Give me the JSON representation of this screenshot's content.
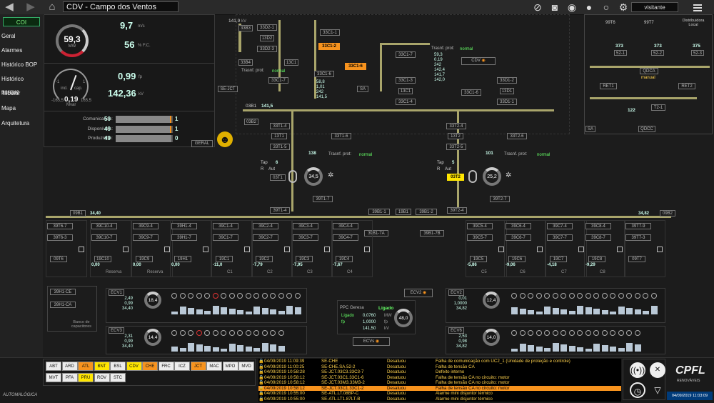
{
  "app": {
    "title": "CDV - Campo dos Ventos",
    "user": "visitante",
    "footer_logo": "AUTOMALÓGICA",
    "brand": "CPFL",
    "brand_sub": "RENOVÁVEIS",
    "datetime": "04/09/2019 11:03:09"
  },
  "toolbar": {
    "back_icon": "back-arrow-icon",
    "forward_icon": "forward-arrow-icon",
    "home_icon": "home-icon",
    "icons": [
      "image-off-icon",
      "camera-icon",
      "eye-icon",
      "user-icon",
      "user-outline-icon",
      "gear-icon"
    ]
  },
  "sidebar": {
    "site": "COI",
    "items": [
      "Geral",
      "Alarmes",
      "Histórico BOP",
      "Histórico parque",
      "Tabular",
      "Mapa",
      "Arquitetura"
    ]
  },
  "summary": {
    "power": "59,3",
    "power_unit": "MW",
    "wind": "9,7",
    "wind_unit": "m/s",
    "fc": "56",
    "fc_unit": "% F.C.",
    "fp_label": "ind.",
    "cap_label": "cap.",
    "fp_min": "-1",
    "fp_max": "1",
    "fp_gauge_val": "0,19",
    "fp_gauge_label": "Mvar",
    "fp_gauge_scale_l": "-165,5",
    "fp_gauge_scale_r": "165,5",
    "fp": "0,99",
    "fp_unit": "fp",
    "kv": "142,36",
    "kv_unit": "kV",
    "rows": [
      {
        "label": "Comunicando:",
        "value": "50",
        "extra": "1",
        "fill": 0.98
      },
      {
        "label": "Disponíveis:",
        "value": "49",
        "extra": "1",
        "fill": 0.98
      },
      {
        "label": "Produzindo:",
        "value": "49",
        "extra": "0",
        "fill": 0.98
      }
    ],
    "geral_btn": "GERAL"
  },
  "substation": {
    "bus_top": "141,9",
    "bus_top_unit": "kV",
    "b1": "33B3",
    "b1_boxes": [
      "33D2-1",
      "13D2",
      "33D2-3"
    ],
    "b4": "33B4",
    "c1_boxes": [
      "33C1-1",
      "13C1",
      "33C1-7",
      "33C1-6"
    ],
    "c1_alarm": "33C1-2",
    "c1_alarm2": "33C1-6",
    "sejct": "SE-JCT",
    "prot_label": "Trasnf. prot:",
    "prot_state": "normal",
    "mv_vals": [
      "58,8",
      "1,01",
      "242",
      "141,5"
    ],
    "cdv_label": "CDV",
    "cdv_vals": [
      "59,3",
      "0,19",
      "242",
      "142,4",
      "141,7",
      "142,0"
    ],
    "c1_right": [
      "33C1-7",
      "33C1-3",
      "13C1",
      "33C1-4",
      "33C1-6"
    ],
    "d1_boxes": [
      "33D1-2",
      "13D1",
      "33D1-1"
    ],
    "bus2": "03B1",
    "bus2_val": "141,5",
    "bus3": "03B2",
    "t1_boxes": [
      "33T1-4",
      "13T1",
      "33T1-5",
      "33T1-6"
    ],
    "t1_val": "138",
    "t2_boxes": [
      "33T2-4",
      "13T2",
      "33T2-5",
      "33T2-6"
    ],
    "t2_val": "101",
    "tap1": "6",
    "tap2": "5",
    "tap_label": "Tap",
    "aut_label": "Aut",
    "r_label": "R",
    "t1_gauge": "34,5",
    "t2_gauge": "25,2",
    "t1_name": "03T1",
    "t2_name": "03T2",
    "t1_lower": [
      "39T1-7",
      "39T1-4"
    ],
    "t2_lower": [
      "39T2-7",
      "39T2-4"
    ],
    "sa_label": "SA",
    "right_top": [
      "99T6",
      "99T7",
      "Distribuidora Local"
    ],
    "right_vals": [
      "373",
      "373",
      "375"
    ],
    "right_boxes": [
      "52-1",
      "52-2",
      "52-3"
    ],
    "right_boxes2": [
      "S3-1",
      "S3-2",
      "S3-3"
    ],
    "qdca": "QDCA",
    "qdca_state": "manual",
    "ret1": "RET1",
    "ret2": "RET2",
    "t2_1": "T2-1",
    "v122": "122",
    "qdcc": "QDCC",
    "sa2": "SA"
  },
  "feeders": {
    "bus_left": "09B1",
    "bus_left_val": "34,40",
    "bus_right": "09B2",
    "bus_right_val": "34,82",
    "tie": [
      "39B1-1",
      "19B1",
      "39B1-2",
      "39B1-7A",
      "39B1-7B"
    ],
    "items": [
      {
        "top": "39T6-7",
        "mid": "39T6-3",
        "bot": "09T6",
        "val": ""
      },
      {
        "top": "39C10-4",
        "mid": "39C10-7",
        "bot": "19C10",
        "val": "0,00",
        "extra": "Reserva"
      },
      {
        "top": "39C9-4",
        "mid": "39C9-7",
        "bot": "19C9",
        "val": "0,00",
        "extra": "Reserva"
      },
      {
        "top": "39H1-4",
        "mid": "39H1-7",
        "bot": "19H1",
        "val": "0,00"
      },
      {
        "top": "39C1-4",
        "mid": "39C1-7",
        "bot": "19C1",
        "val": "-11,0",
        "extra": "C1"
      },
      {
        "top": "39C2-4",
        "mid": "39C2-7",
        "bot": "19C2",
        "val": "-7,79",
        "extra": "C2"
      },
      {
        "top": "39C3-4",
        "mid": "39C3-7",
        "bot": "19C3",
        "val": "-7,95",
        "extra": "C3"
      },
      {
        "top": "39C4-4",
        "mid": "39C4-7",
        "bot": "19C4",
        "val": "-7,67",
        "extra": "C4"
      },
      {
        "top": "39C5-4",
        "mid": "39C5-7",
        "bot": "19C5",
        "val": "-5,86",
        "extra": "C5"
      },
      {
        "top": "39C6-4",
        "mid": "39C6-7",
        "bot": "19C6",
        "val": "-9,06",
        "extra": "C6"
      },
      {
        "top": "39C7-4",
        "mid": "39C7-7",
        "bot": "19C7",
        "val": "-4,18",
        "extra": "C7"
      },
      {
        "top": "39C8-4",
        "mid": "39C8-7",
        "bot": "19C8",
        "val": "-9,29",
        "extra": "C8"
      },
      {
        "top": "39T7-9",
        "mid": "39T7-3",
        "bot": "09T7",
        "val": ""
      }
    ],
    "bank_boxes": [
      "39H1-CE",
      "39H1-CA"
    ],
    "bank_label": "Banco de capacitores"
  },
  "ecv": [
    {
      "name": "ECV1",
      "vals": [
        "2,49",
        "0,99",
        "34,40"
      ],
      "units": [
        "MW",
        "fp",
        "kV"
      ],
      "gauge": "18,4"
    },
    {
      "name": "ECV3",
      "vals": [
        "2,31",
        "0,99",
        "34,40"
      ],
      "units": [
        "MW",
        "fp",
        "kV"
      ],
      "gauge": "14,4"
    },
    {
      "name": "ECV2",
      "vals": [
        "0,01",
        "1,0000",
        "34,82"
      ],
      "units": [
        "MW",
        "fp",
        "kV"
      ],
      "gauge": "12,4"
    },
    {
      "name": "ECV6",
      "vals": [
        "2,53",
        "0,98",
        "34,82"
      ],
      "units": [
        "MW",
        "fp",
        "kV"
      ],
      "gauge": "14,0"
    }
  ],
  "ppc": {
    "title": "PPC Geresa",
    "state": "Ligado",
    "rows": [
      [
        "Ligado",
        "0,0760",
        "MW"
      ],
      [
        "fp",
        "1,0000",
        "fp"
      ],
      [
        "",
        "141,50",
        "kV"
      ]
    ],
    "gauge": "48,0",
    "ecv2_btn": "ECV2",
    "ecvs_btn": "ECVs"
  },
  "units": {
    "rows": [
      [
        "ABT",
        "ARD",
        "ATL",
        "BNT",
        "BSL",
        "CDV",
        "CHE",
        "FRC",
        "ICZ",
        "JCT",
        "MAC",
        "MPO",
        "MVD"
      ],
      [
        "MVT",
        "PFA",
        "PRU",
        "ROV",
        "STC"
      ]
    ],
    "colors": {
      "ATL": "#f7931e",
      "BNT": "#ffe600",
      "CDV": "#ffe600",
      "CHE": "#f7931e",
      "JCT": "#f7931e",
      "PRU": "#ffe600"
    }
  },
  "alarms": [
    {
      "date": "04/09/2019 11:09:39",
      "loc": "SE-CHE",
      "state": "Desatuou",
      "desc": "Falha de comunicação com UC2_1 (Unidade de proteção e controle)",
      "sel": false
    },
    {
      "date": "04/09/2019 11:00:25",
      "loc": "SE-CHE.SA.52-2",
      "state": "Desatuou",
      "desc": "Falha de tensão CA",
      "sel": false
    },
    {
      "date": "04/09/2019 10:58:28",
      "loc": "SE-JCT.03C3.33C3-7",
      "state": "Desatuou",
      "desc": "Defeito interno",
      "sel": false
    },
    {
      "date": "04/09/2019 10:58:12",
      "loc": "SE-JCT.03C1.33C1-6",
      "state": "Desatuou",
      "desc": "Falha de tensão CA no circuito: motor",
      "sel": false
    },
    {
      "date": "04/09/2019 10:58:12",
      "loc": "SE-JCT.03M3.33M3-2",
      "state": "Desatuou",
      "desc": "Falha de tensão CA no circuito: motor",
      "sel": false
    },
    {
      "date": "04/09/2019 10:58:12",
      "loc": "SE-JCT.03C1.33C1-2",
      "state": "Desatuou",
      "desc": "Falha de tensão CA no circuito: motor",
      "sel": true
    },
    {
      "date": "04/09/2019 10:55:00",
      "loc": "SE-ATL.LT.08BP-C",
      "state": "Desatuou",
      "desc": "Alarme mini disjuntor térmico",
      "sel": false
    },
    {
      "date": "04/09/2019 10:55:00",
      "loc": "SE-ATL.LT1.87LT-B",
      "state": "Desatuou",
      "desc": "Alarme mini disjuntor térmico",
      "sel": false
    }
  ],
  "right_buttons": [
    "sound-icon",
    "mute-icon",
    "clock-icon",
    "filter-icon"
  ]
}
